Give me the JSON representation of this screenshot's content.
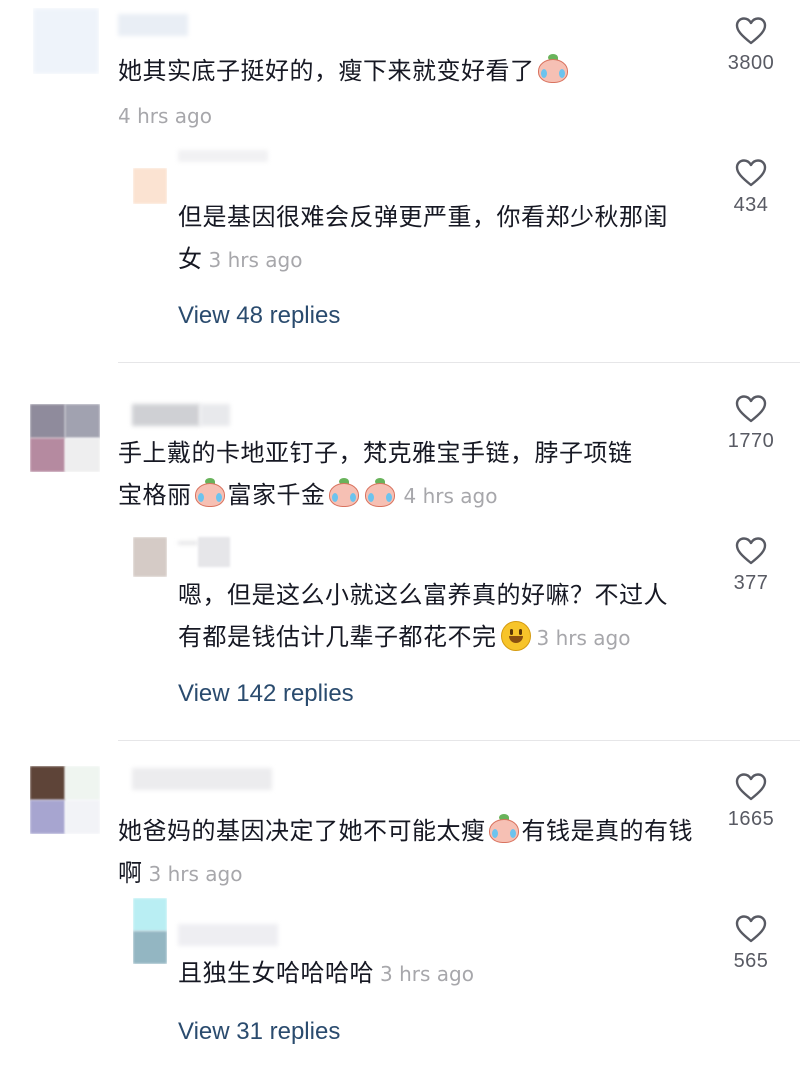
{
  "comments": [
    {
      "text": "她其实底子挺好的，瘦下来就变好看了",
      "time": "4 hrs ago",
      "likes": "3800",
      "reply": {
        "text": "但是基因很难会反弹更严重，你看郑少秋那闺女",
        "time": "3 hrs ago",
        "likes": "434"
      },
      "view_replies": "View 48 replies"
    },
    {
      "text_part1": "手上戴的卡地亚钉子，梵克雅宝手链，脖子项链",
      "text_part2": "宝格丽",
      "text_part3": "富家千金",
      "time": "4 hrs ago",
      "likes": "1770",
      "reply": {
        "text": "嗯，但是这么小就这么富养真的好嘛？不过人有都是钱估计几辈子都花不完",
        "time": "3 hrs ago",
        "likes": "377"
      },
      "view_replies": "View 142 replies"
    },
    {
      "text_part1": "她爸妈的基因决定了她不可能太瘦",
      "text_part2": "有钱是真的有钱啊",
      "time": "3 hrs ago",
      "likes": "1665",
      "reply": {
        "text": "且独生女哈哈哈哈",
        "time": "3 hrs ago",
        "likes": "565"
      },
      "view_replies": "View 31 replies"
    }
  ],
  "icons": {
    "like": "heart-outline-icon",
    "emoji_cry": "crying-peach-emoji-icon",
    "emoji_smile": "smiling-face-emoji-icon"
  },
  "colors": {
    "link": "#2a4b6e",
    "time": "#a7a7ab",
    "count": "#585a63"
  }
}
